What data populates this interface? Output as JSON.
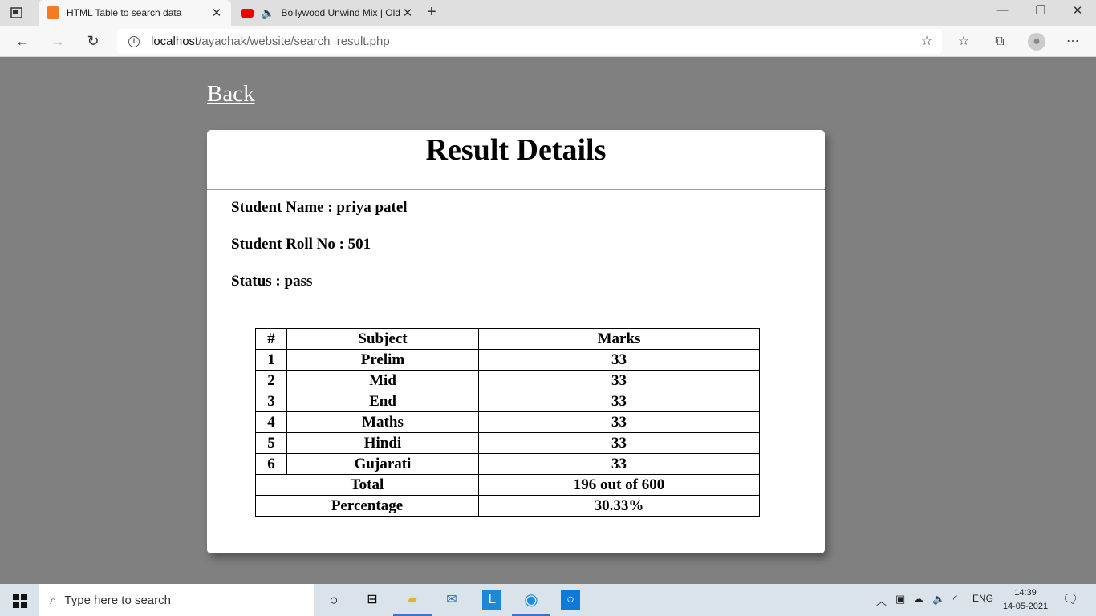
{
  "browser": {
    "tabs": [
      {
        "title": "HTML Table to search data",
        "active": true,
        "icon": "xampp-icon"
      },
      {
        "title": "Bollywood Unwind Mix | Old",
        "active": false,
        "icon": "youtube-icon"
      }
    ],
    "url_host": "localhost",
    "url_path": "/ayachak/website/search_result.php"
  },
  "page": {
    "back_label": "Back",
    "heading": "Result Details",
    "student_name": "Student Name : priya patel",
    "roll_no": "Student Roll No : 501",
    "status": "Status : pass",
    "table": {
      "headers": [
        "#",
        "Subject",
        "Marks"
      ],
      "rows": [
        {
          "num": "1",
          "subject": "Prelim",
          "marks": "33"
        },
        {
          "num": "2",
          "subject": "Mid",
          "marks": "33"
        },
        {
          "num": "3",
          "subject": "End",
          "marks": "33"
        },
        {
          "num": "4",
          "subject": "Maths",
          "marks": "33"
        },
        {
          "num": "5",
          "subject": "Hindi",
          "marks": "33"
        },
        {
          "num": "6",
          "subject": "Gujarati",
          "marks": "33"
        }
      ],
      "total_label": "Total",
      "total_value": "196 out of 600",
      "percentage_label": "Percentage",
      "percentage_value": "30.33%"
    }
  },
  "taskbar": {
    "search_placeholder": "Type here to search",
    "language": "ENG",
    "time": "14:39",
    "date": "14-05-2021"
  },
  "colors": {
    "page_bg": "#808080",
    "card_bg": "#ffffff",
    "accent": "#3a76c4"
  }
}
